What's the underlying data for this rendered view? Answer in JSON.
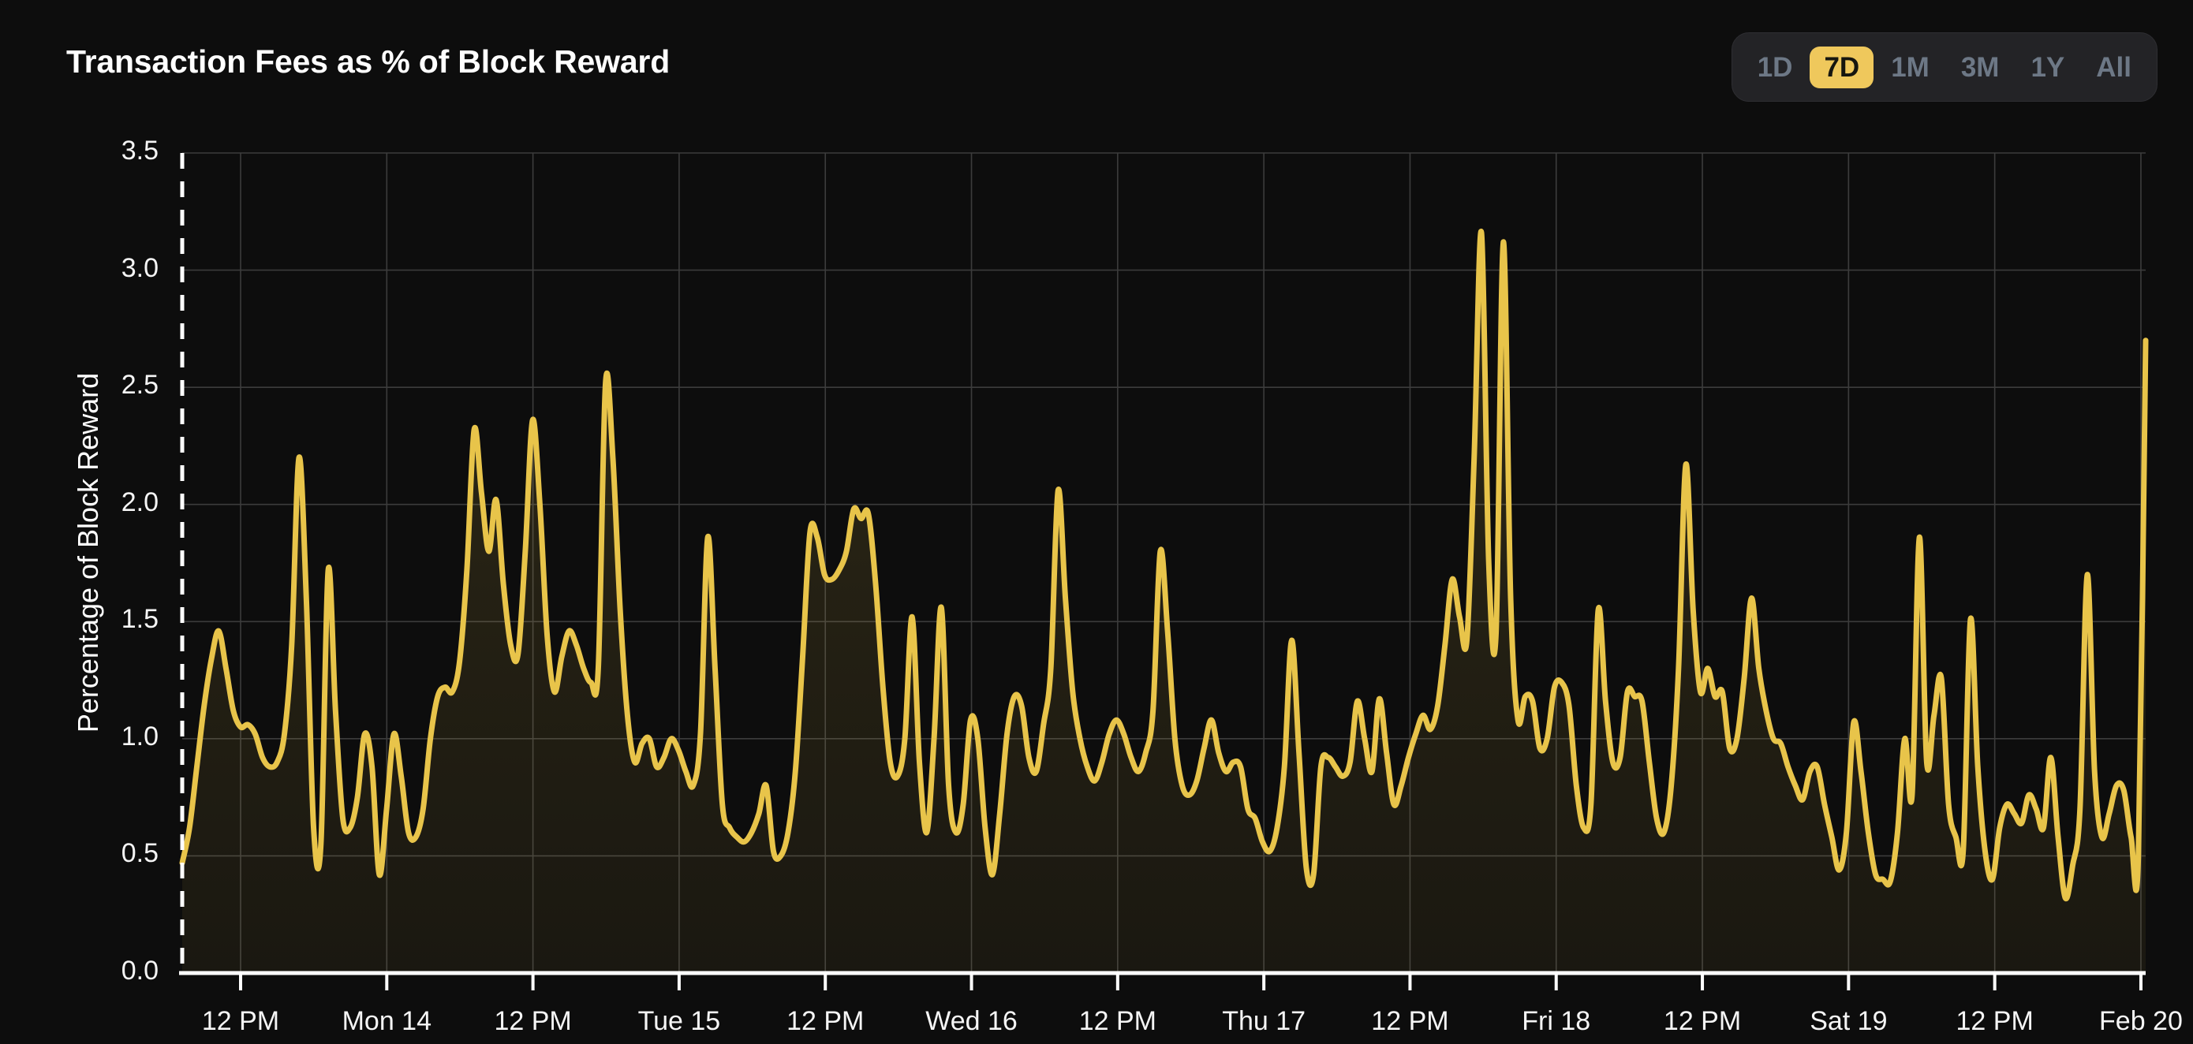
{
  "header": {
    "title": "Transaction Fees as % of Block Reward"
  },
  "range_selector": {
    "options": [
      {
        "label": "1D",
        "active": false
      },
      {
        "label": "7D",
        "active": true
      },
      {
        "label": "1M",
        "active": false
      },
      {
        "label": "3M",
        "active": false
      },
      {
        "label": "1Y",
        "active": false
      },
      {
        "label": "All",
        "active": false
      }
    ],
    "active_label": "7D"
  },
  "colors": {
    "background": "#0d0d0d",
    "line": "#e8c44a",
    "fill": "#1e1b11",
    "grid": "#3a3a3a",
    "axis": "#ffffff",
    "accent": "#efc85c",
    "inactive_text": "#6d7886",
    "selector_bg": "#232326",
    "text": "#ffffff"
  },
  "chart_data": {
    "type": "area",
    "title": "Transaction Fees as % of Block Reward",
    "xlabel": "",
    "ylabel": "Percentage of Block Reward",
    "ylim": [
      0.0,
      3.5
    ],
    "ytick_labels": [
      "0.0",
      "0.5",
      "1.0",
      "1.5",
      "2.0",
      "2.5",
      "3.0",
      "3.5"
    ],
    "ytick_values": [
      0.0,
      0.5,
      1.0,
      1.5,
      2.0,
      2.5,
      3.0,
      3.5
    ],
    "xtick_labels": [
      "12 PM",
      "Mon 14",
      "12 PM",
      "Tue 15",
      "12 PM",
      "Wed 16",
      "12 PM",
      "Thu 17",
      "12 PM",
      "Fri 18",
      "12 PM",
      "Sat 19",
      "12 PM",
      "Feb 20"
    ],
    "grid": true,
    "legend": "none",
    "series": [
      {
        "name": "Transaction Fees as % of Block Reward",
        "color": "#e8c44a",
        "values": [
          0.47,
          0.62,
          0.88,
          1.14,
          1.34,
          1.46,
          1.3,
          1.12,
          1.05,
          1.06,
          1.02,
          0.92,
          0.88,
          0.9,
          1.02,
          1.4,
          2.2,
          1.6,
          0.62,
          0.55,
          1.72,
          1.12,
          0.66,
          0.62,
          0.75,
          1.02,
          0.88,
          0.42,
          0.7,
          1.02,
          0.84,
          0.6,
          0.58,
          0.7,
          1.0,
          1.18,
          1.22,
          1.2,
          1.33,
          1.72,
          2.32,
          2.05,
          1.8,
          2.02,
          1.66,
          1.4,
          1.36,
          1.8,
          2.36,
          2.0,
          1.44,
          1.2,
          1.35,
          1.46,
          1.4,
          1.3,
          1.24,
          1.3,
          2.52,
          2.2,
          1.55,
          1.1,
          0.9,
          0.98,
          1.0,
          0.88,
          0.92,
          1.0,
          0.95,
          0.86,
          0.8,
          1.02,
          1.86,
          1.3,
          0.72,
          0.62,
          0.58,
          0.56,
          0.6,
          0.68,
          0.8,
          0.52,
          0.5,
          0.6,
          0.86,
          1.35,
          1.88,
          1.86,
          1.7,
          1.68,
          1.72,
          1.8,
          1.98,
          1.94,
          1.96,
          1.66,
          1.22,
          0.9,
          0.84,
          1.0,
          1.52,
          0.9,
          0.6,
          1.0,
          1.56,
          0.8,
          0.6,
          0.72,
          1.08,
          1.0,
          0.62,
          0.42,
          0.68,
          1.02,
          1.18,
          1.14,
          0.92,
          0.86,
          1.06,
          1.3,
          2.06,
          1.6,
          1.2,
          1.0,
          0.88,
          0.82,
          0.9,
          1.02,
          1.08,
          1.02,
          0.92,
          0.86,
          0.94,
          1.12,
          1.8,
          1.46,
          1.0,
          0.8,
          0.76,
          0.82,
          0.96,
          1.08,
          0.94,
          0.86,
          0.9,
          0.88,
          0.7,
          0.66,
          0.56,
          0.52,
          0.62,
          0.88,
          1.42,
          0.94,
          0.45,
          0.42,
          0.88,
          0.92,
          0.88,
          0.84,
          0.9,
          1.16,
          1.0,
          0.86,
          1.17,
          0.94,
          0.72,
          0.8,
          0.92,
          1.02,
          1.1,
          1.04,
          1.14,
          1.4,
          1.68,
          1.52,
          1.42,
          2.2,
          3.16,
          1.75,
          1.45,
          3.12,
          1.6,
          1.08,
          1.18,
          1.16,
          0.96,
          1.0,
          1.22,
          1.24,
          1.14,
          0.8,
          0.62,
          0.72,
          1.55,
          1.16,
          0.9,
          0.92,
          1.2,
          1.18,
          1.16,
          0.9,
          0.66,
          0.6,
          0.8,
          1.3,
          2.17,
          1.55,
          1.2,
          1.3,
          1.18,
          1.2,
          0.96,
          1.0,
          1.26,
          1.6,
          1.3,
          1.12,
          1.0,
          0.98,
          0.88,
          0.8,
          0.74,
          0.86,
          0.88,
          0.72,
          0.58,
          0.44,
          0.6,
          1.07,
          0.86,
          0.6,
          0.42,
          0.4,
          0.39,
          0.6,
          1.0,
          0.76,
          1.86,
          0.9,
          1.1,
          1.26,
          0.72,
          0.58,
          0.52,
          1.51,
          0.88,
          0.52,
          0.4,
          0.62,
          0.72,
          0.68,
          0.64,
          0.76,
          0.7,
          0.62,
          0.92,
          0.58,
          0.32,
          0.46,
          0.7,
          1.7,
          0.86,
          0.58,
          0.68,
          0.8,
          0.78,
          0.58,
          0.5,
          2.7
        ]
      }
    ]
  }
}
